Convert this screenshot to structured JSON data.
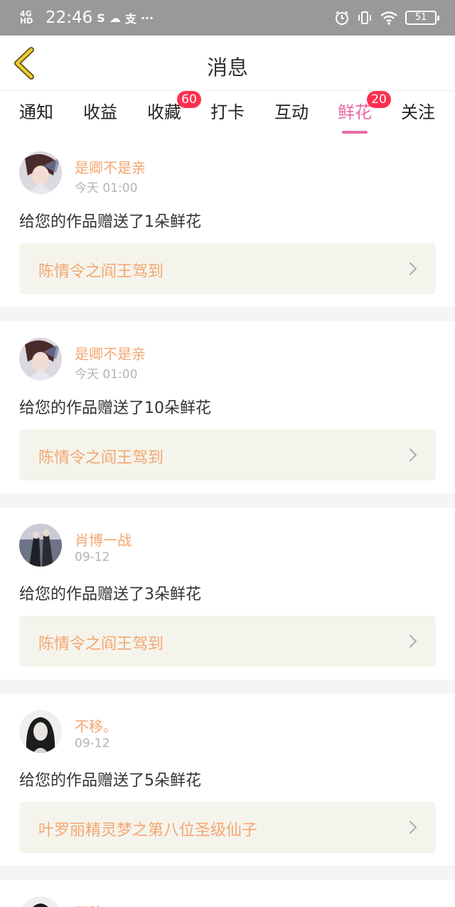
{
  "status_bar": {
    "network": "4G HD",
    "time": "22:46",
    "notif_icons": [
      "S",
      "☁",
      "支",
      "···"
    ],
    "battery": "51"
  },
  "header": {
    "title": "消息",
    "back_icon": "chevron-left-icon"
  },
  "colors": {
    "accent": "#e96aa5",
    "name_color": "#f4a671",
    "badge": "#ff2f4f",
    "card_link_bg": "#f5f4ec"
  },
  "tabs": [
    {
      "label": "通知",
      "badge": ""
    },
    {
      "label": "收益",
      "badge": ""
    },
    {
      "label": "收藏",
      "badge": "60"
    },
    {
      "label": "打卡",
      "badge": ""
    },
    {
      "label": "互动",
      "badge": ""
    },
    {
      "label": "鲜花",
      "badge": "20",
      "active": true
    },
    {
      "label": "关注",
      "badge": ""
    }
  ],
  "messages": [
    {
      "user": "是卿不是亲",
      "time": "今天 01:00",
      "text": "给您的作品赠送了1朵鲜花",
      "work": "陈情令之阎王驾到"
    },
    {
      "user": "是卿不是亲",
      "time": "今天 01:00",
      "text": "给您的作品赠送了10朵鲜花",
      "work": "陈情令之阎王驾到"
    },
    {
      "user": "肖博一战",
      "time": "09-12",
      "text": "给您的作品赠送了3朵鲜花",
      "work": "陈情令之阎王驾到"
    },
    {
      "user": "不移。",
      "time": "09-12",
      "text": "给您的作品赠送了5朵鲜花",
      "work": "叶罗丽精灵梦之第八位圣级仙子"
    }
  ],
  "partial_next_user": "不移。"
}
